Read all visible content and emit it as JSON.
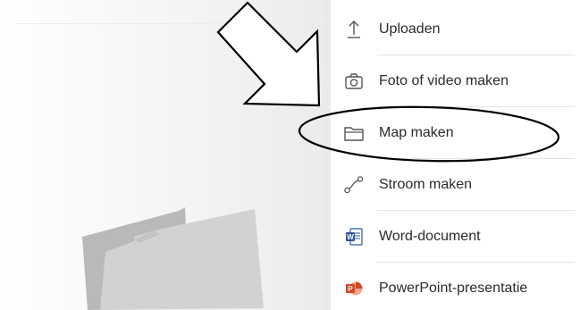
{
  "menu": {
    "items": [
      {
        "label": "Uploaden",
        "icon": "upload-icon"
      },
      {
        "label": "Foto of video maken",
        "icon": "camera-icon"
      },
      {
        "label": "Map maken",
        "icon": "folder-icon"
      },
      {
        "label": "Stroom maken",
        "icon": "flow-icon"
      },
      {
        "label": "Word-document",
        "icon": "word-icon"
      },
      {
        "label": "PowerPoint-presentatie",
        "icon": "powerpoint-icon"
      }
    ]
  },
  "colors": {
    "word_blue": "#2b579a",
    "powerpoint_red": "#d24726",
    "icon_gray": "#555555",
    "annotation_black": "#000000"
  },
  "annotations": {
    "arrow": "arrow-pointing-to-map-maken",
    "highlight": "ellipse-around-map-maken"
  }
}
